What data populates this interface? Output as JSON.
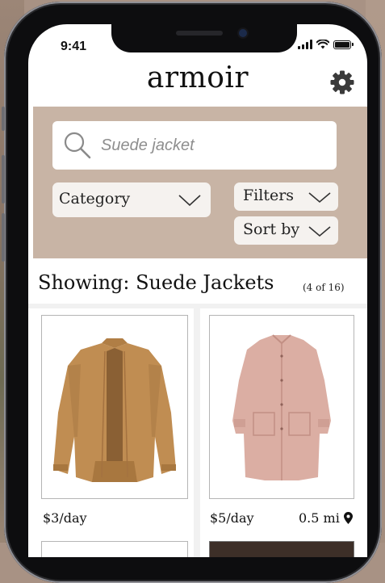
{
  "status_bar": {
    "time": "9:41"
  },
  "header": {
    "app_title": "armoir",
    "settings_icon": "gear-icon"
  },
  "search": {
    "query": "Suede jacket",
    "icon": "search-icon"
  },
  "filters": {
    "category_label": "Category",
    "filters_label": "Filters",
    "sort_label": "Sort by"
  },
  "results": {
    "heading": "Showing: Suede Jackets",
    "count": "(4 of 16)",
    "items": [
      {
        "name": "tan suede bomber jacket",
        "price": "$3/day",
        "distance": ""
      },
      {
        "name": "pink suede coat",
        "price": "$5/day",
        "distance": "0.5 mi"
      }
    ]
  },
  "colors": {
    "filter_panel": "#c8b4a5",
    "tan_jacket": "#c08d52",
    "pink_coat": "#dbaea3"
  }
}
